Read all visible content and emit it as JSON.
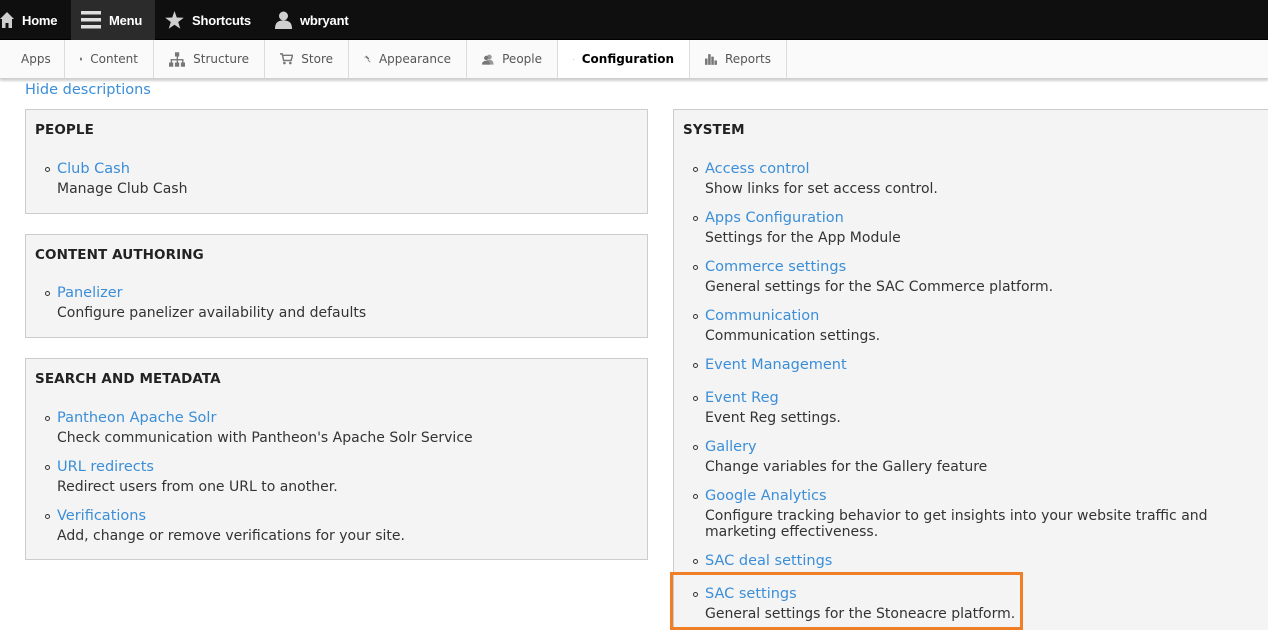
{
  "toolbar": {
    "home_label": "Home",
    "menu_label": "Menu",
    "shortcuts_label": "Shortcuts",
    "user_label": "wbryant"
  },
  "tray": {
    "items": [
      {
        "label": "Apps",
        "icon": "none"
      },
      {
        "label": "Content",
        "icon": "page-icon"
      },
      {
        "label": "Structure",
        "icon": "sitemap-icon"
      },
      {
        "label": "Store",
        "icon": "cart-icon"
      },
      {
        "label": "Appearance",
        "icon": "paintbrush-icon"
      },
      {
        "label": "People",
        "icon": "people-icon"
      },
      {
        "label": "Configuration",
        "icon": "wrench-icon"
      },
      {
        "label": "Reports",
        "icon": "bar-chart-icon"
      }
    ],
    "active": "Configuration"
  },
  "content": {
    "hide_descriptions": "Hide descriptions"
  },
  "panels": {
    "people": {
      "title": "PEOPLE",
      "items": [
        {
          "link": "Club Cash",
          "desc": "Manage Club Cash"
        }
      ]
    },
    "content_authoring": {
      "title": "CONTENT AUTHORING",
      "items": [
        {
          "link": "Panelizer",
          "desc": "Configure panelizer availability and defaults"
        }
      ]
    },
    "search_metadata": {
      "title": "SEARCH AND METADATA",
      "items": [
        {
          "link": "Pantheon Apache Solr",
          "desc": "Check communication with Pantheon's Apache Solr Service"
        },
        {
          "link": "URL redirects",
          "desc": "Redirect users from one URL to another."
        },
        {
          "link": "Verifications",
          "desc": "Add, change or remove verifications for your site."
        }
      ]
    },
    "system": {
      "title": "SYSTEM",
      "items": [
        {
          "link": "Access control",
          "desc": "Show links for set access control."
        },
        {
          "link": "Apps Configuration",
          "desc": "Settings for the App Module"
        },
        {
          "link": "Commerce settings",
          "desc": "General settings for the SAC Commerce platform."
        },
        {
          "link": "Communication",
          "desc": "Communication settings."
        },
        {
          "link": "Event Management",
          "desc": ""
        },
        {
          "link": "Event Reg",
          "desc": "Event Reg settings."
        },
        {
          "link": "Gallery",
          "desc": "Change variables for the Gallery feature"
        },
        {
          "link": "Google Analytics",
          "desc": "Configure tracking behavior to get insights into your website traffic and marketing effectiveness."
        },
        {
          "link": "SAC deal settings",
          "desc": ""
        },
        {
          "link": "SAC settings",
          "desc": "General settings for the Stoneacre platform."
        }
      ]
    }
  },
  "colors": {
    "link": "#3b8ed8",
    "toolbar_bg": "#0f0f0f",
    "highlight": "#f07e26"
  }
}
